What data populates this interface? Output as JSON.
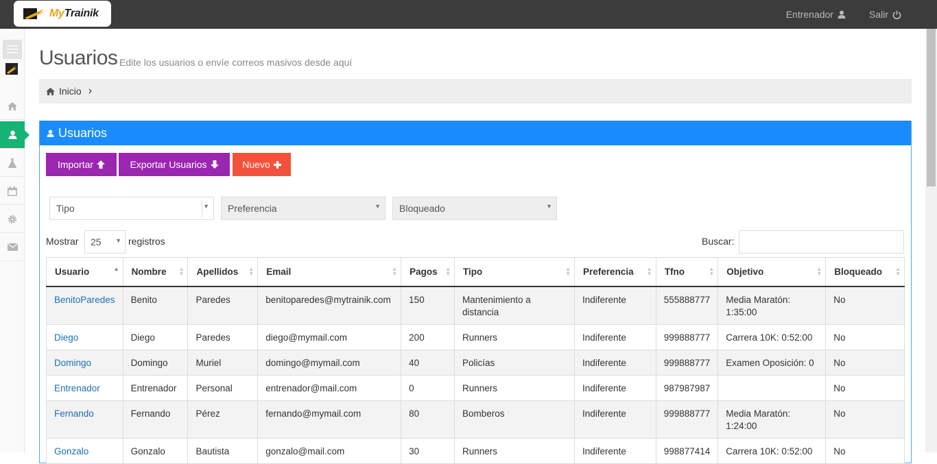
{
  "app": {
    "brand_my": "My",
    "brand_trainik": "Trainik"
  },
  "topbar": {
    "user_label": "Entrenador",
    "logout_label": "Salir"
  },
  "page": {
    "title": "Usuarios",
    "subtitle": "Edite los usuarios o envíe correos masivos desde aquí"
  },
  "breadcrumb": {
    "home": "Inicio",
    "separator": "›"
  },
  "portlet": {
    "title": "Usuarios"
  },
  "buttons": {
    "import": "Importar",
    "export": "Exportar Usuarios",
    "new": "Nuevo"
  },
  "filters": {
    "tipo": "Tipo",
    "preferencia": "Preferencia",
    "bloqueado": "Bloqueado"
  },
  "length": {
    "prefix": "Mostrar",
    "value": "25",
    "suffix": "registros"
  },
  "search": {
    "label": "Buscar:",
    "value": ""
  },
  "table": {
    "headers": [
      "Usuario",
      "Nombre",
      "Apellidos",
      "Email",
      "Pagos",
      "Tipo",
      "Preferencia",
      "Tfno",
      "Objetivo",
      "Bloqueado"
    ],
    "rows": [
      [
        "BenitoParedes",
        "Benito",
        "Paredes",
        "benitoparedes@mytrainik.com",
        "150",
        "Mantenimiento a distancia",
        "Indiferente",
        "555888777",
        "Media Maratón: 1:35:00",
        "No"
      ],
      [
        "Diego",
        "Diego",
        "Paredes",
        "diego@mymail.com",
        "200",
        "Runners",
        "Indiferente",
        "999888777",
        "Carrera 10K: 0:52:00",
        "No"
      ],
      [
        "Domingo",
        "Domingo",
        "Muriel",
        "domingo@mymail.com",
        "40",
        "Policías",
        "Indiferente",
        "999888777",
        "Examen Oposición: 0",
        "No"
      ],
      [
        "Entrenador",
        "Entrenador",
        "Personal",
        "entrenador@mail.com",
        "0",
        "Runners",
        "Indiferente",
        "987987987",
        "",
        "No"
      ],
      [
        "Fernando",
        "Fernando",
        "Pérez",
        "fernando@mymail.com",
        "80",
        "Bomberos",
        "Indiferente",
        "999888777",
        "Media Maratón: 1:24:00",
        "No"
      ],
      [
        "Gonzalo",
        "Gonzalo",
        "Bautista",
        "gonzalo@mail.com",
        "30",
        "Runners",
        "Indiferente",
        "998877414",
        "Carrera 10K: 0:52:00",
        "No"
      ]
    ]
  },
  "colors": {
    "topbar": "#3c3c3c",
    "accent_green": "#15b374",
    "portlet_blue": "#1a8cff",
    "purple": "#9b26af",
    "red": "#f3513b"
  },
  "icons": {
    "user": "user-icon",
    "power": "power-icon",
    "home": "home-icon",
    "flask": "flask-icon",
    "calendar": "calendar-icon",
    "gear": "gear-icon",
    "envelope": "envelope-icon"
  }
}
